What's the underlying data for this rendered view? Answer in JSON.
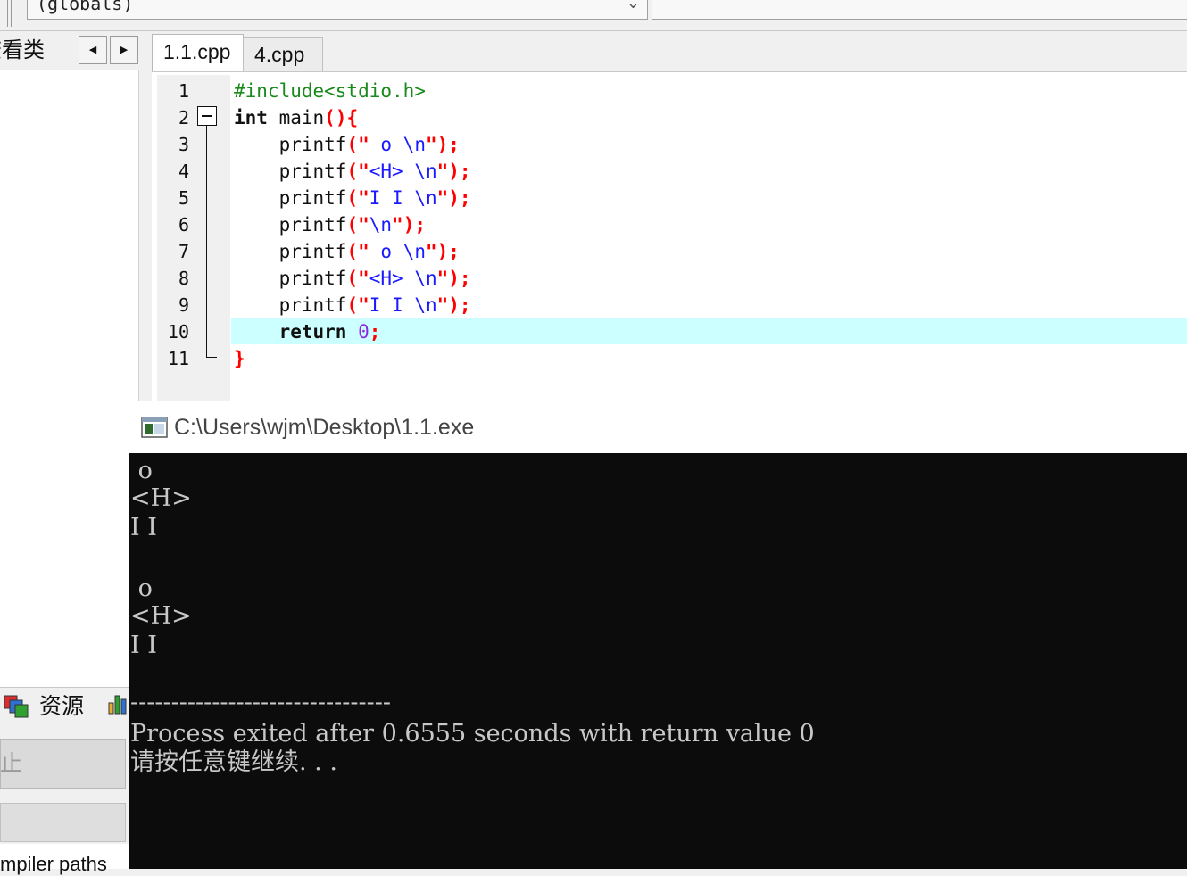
{
  "toolbar": {
    "scope_value": "(globals)"
  },
  "left_panel": {
    "tab_label": "查看类"
  },
  "editor": {
    "tabs": [
      {
        "label": "1.1.cpp"
      },
      {
        "label": "4.cpp"
      }
    ],
    "line_numbers": [
      "1",
      "2",
      "3",
      "4",
      "5",
      "6",
      "7",
      "8",
      "9",
      "10",
      "11"
    ],
    "current_line": 10,
    "code_lines": [
      "#include<stdio.h>",
      "int main(){",
      "    printf(\" o \\n\");",
      "    printf(\"<H> \\n\");",
      "    printf(\"I I \\n\");",
      "    printf(\"\\n\");",
      "    printf(\" o \\n\");",
      "    printf(\"<H> \\n\");",
      "    printf(\"I I \\n\");",
      "    return 0;",
      "}"
    ]
  },
  "console": {
    "title": "C:\\Users\\wjm\\Desktop\\1.1.exe",
    "lines": [
      " o",
      "<H>",
      "I I",
      "",
      " o",
      "<H>",
      "I I",
      "",
      "--------------------------------",
      "Process exited after 0.6555 seconds with return value 0",
      "请按任意键继续. . ."
    ]
  },
  "bottom_panel": {
    "resources_label": "资源",
    "stop_label": "止",
    "compiler_label": "mpiler paths"
  },
  "colors": {
    "current_line_bg": "#ccffff",
    "preprocessor": "#1a8a1a",
    "punctuation": "#ff0000",
    "string": "#1a1aff",
    "number": "#8a2be2",
    "console_bg": "#0c0c0c"
  }
}
